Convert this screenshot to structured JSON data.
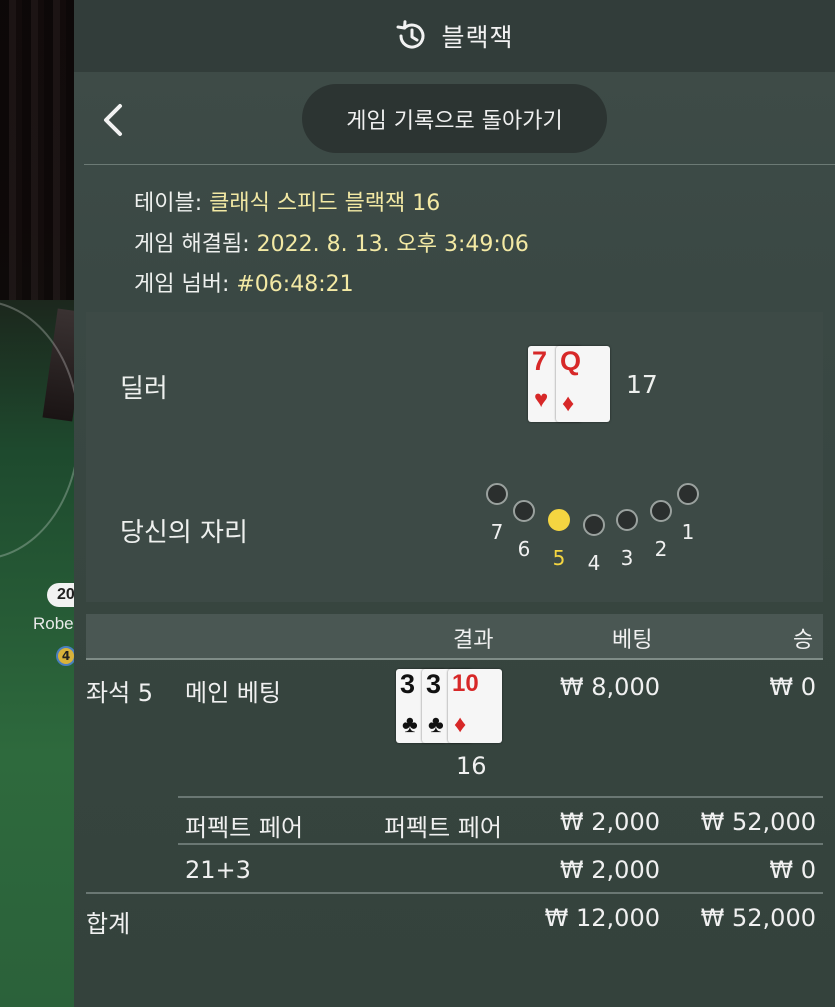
{
  "background": {
    "player_chip": "20",
    "player_name": "Robe",
    "player_level": "4"
  },
  "header": {
    "title": "블랙잭",
    "icon": "history-icon"
  },
  "nav": {
    "back_icon": "chevron-left-icon",
    "back_label": "게임 기록으로 돌아가기"
  },
  "info": {
    "table_label": "테이블: ",
    "table_value": "클래식 스피드 블랙잭 16",
    "resolved_label": "게임 해결됨: ",
    "resolved_value": "2022. 8. 13. 오후 3:49:06",
    "number_label": "게임 넘버: ",
    "number_value": "#06:48:21"
  },
  "dealer": {
    "label": "딜러",
    "total": "17",
    "cards": [
      {
        "rank": "7",
        "suit": "♥",
        "color": "red"
      },
      {
        "rank": "Q",
        "suit": "♦",
        "color": "red"
      }
    ]
  },
  "seat": {
    "label": "당신의 자리",
    "seats": [
      "7",
      "6",
      "5",
      "4",
      "3",
      "2",
      "1"
    ],
    "selected": "5"
  },
  "table": {
    "headers": {
      "result": "결과",
      "bet": "베팅",
      "win": "승"
    },
    "main": {
      "seat": "좌석 5",
      "name": "메인 베팅",
      "cards": [
        {
          "rank": "3",
          "suit": "♣",
          "color": "black"
        },
        {
          "rank": "3",
          "suit": "♣",
          "color": "black"
        },
        {
          "rank": "10",
          "suit": "♦",
          "color": "red"
        }
      ],
      "total": "16",
      "bet": "₩ 8,000",
      "win": "₩ 0"
    },
    "perfect_pair": {
      "name": "퍼펙트 페어",
      "result": "퍼펙트 페어",
      "bet": "₩ 2,000",
      "win": "₩ 52,000"
    },
    "twentyone_three": {
      "name": "21+3",
      "bet": "₩ 2,000",
      "win": "₩ 0"
    },
    "total": {
      "label": "합계",
      "bet": "₩ 12,000",
      "win": "₩ 52,000"
    }
  },
  "colors": {
    "accent_value": "#f3e9a4",
    "selected_seat": "#f4d541",
    "card_red": "#d72828"
  }
}
